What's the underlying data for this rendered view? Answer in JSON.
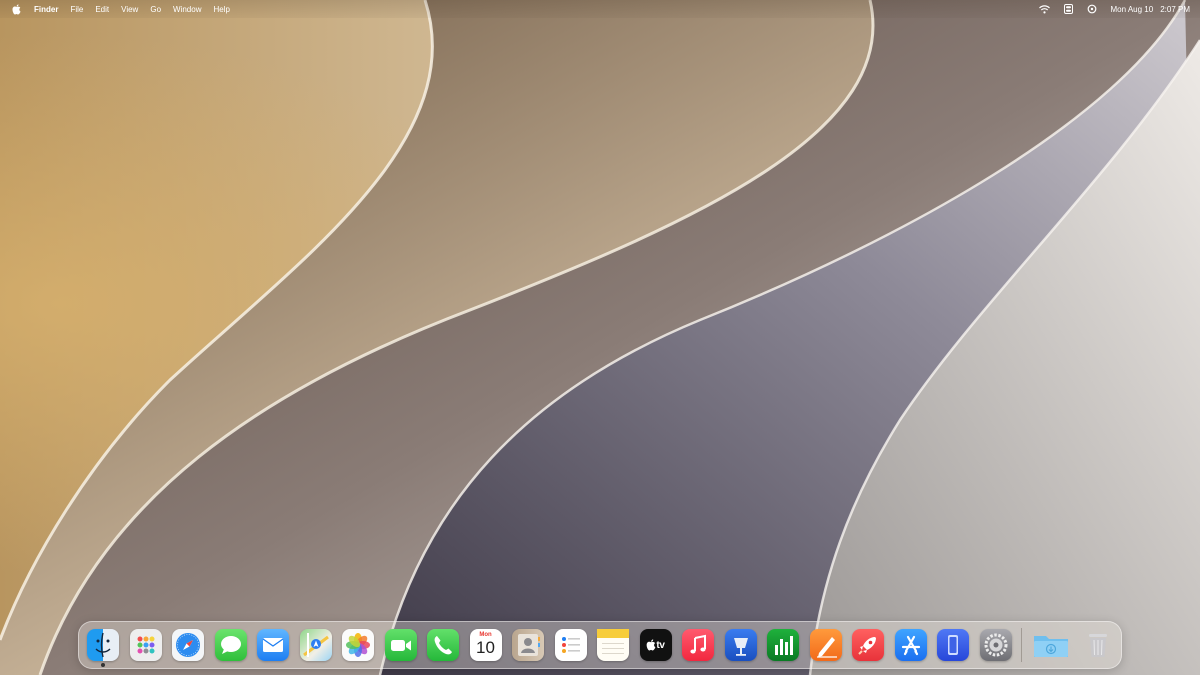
{
  "menubar": {
    "apple_icon": "apple-logo-icon",
    "app_name": "Finder",
    "menus": [
      "File",
      "Edit",
      "View",
      "Go",
      "Window",
      "Help"
    ],
    "status_icons": [
      "wifi-icon",
      "control-center-icon",
      "spotlight-icon"
    ],
    "date": "Mon Aug 10",
    "time": "2:07 PM"
  },
  "calendar": {
    "month": "Mon",
    "day": "10"
  },
  "tv": {
    "label": "tv"
  },
  "dock": {
    "apps": [
      "Finder",
      "Launchpad",
      "Safari",
      "Messages",
      "Mail",
      "Maps",
      "Photos",
      "FaceTime",
      "Phone",
      "Calendar",
      "Contacts",
      "Reminders",
      "Notes",
      "TV",
      "Music",
      "Keynote",
      "Numbers",
      "Pages",
      "Rocket",
      "App Store",
      "iPhone Mirroring",
      "System Settings",
      "Downloads",
      "Trash"
    ],
    "running_apps": [
      "Finder"
    ]
  },
  "colors": {
    "menubar_text": "#ffffff",
    "dock_background": "rgba(235,228,220,0.38)"
  }
}
